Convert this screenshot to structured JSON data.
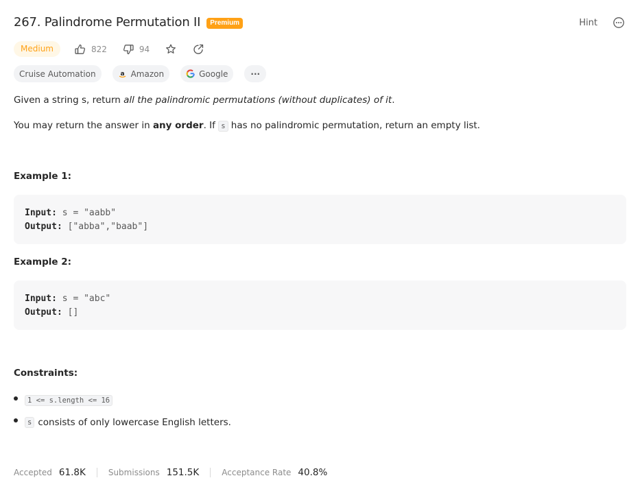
{
  "problem": {
    "title": "267. Palindrome Permutation II",
    "premium_badge": "Premium",
    "difficulty": "Medium",
    "likes": "822",
    "dislikes": "94"
  },
  "header_actions": {
    "hint": "Hint"
  },
  "tags": [
    {
      "label": "Cruise Automation"
    },
    {
      "label": "Amazon",
      "icon": "amazon-logo"
    },
    {
      "label": "Google",
      "icon": "google-logo"
    },
    {
      "label": "···"
    }
  ],
  "description": {
    "p1_prefix": "Given a string s, return ",
    "p1_em": "all the palindromic permutations (without duplicates) of it",
    "p1_suffix": ".",
    "p2_prefix": "You may return the answer in ",
    "p2_bold": "any order",
    "p2_mid": ". If ",
    "p2_code": "s",
    "p2_suffix": " has no palindromic permutation, return an empty list."
  },
  "examples": [
    {
      "title": "Example 1:",
      "input_label": "Input:",
      "input": " s = \"aabb\"",
      "output_label": "Output:",
      "output": " [\"abba\",\"baab\"]"
    },
    {
      "title": "Example 2:",
      "input_label": "Input:",
      "input": " s = \"abc\"",
      "output_label": "Output:",
      "output": " []"
    }
  ],
  "constraints": {
    "title": "Constraints:",
    "item1_code": "1 <= s.length <= 16",
    "item2_code": "s",
    "item2_text": "consists of only lowercase English letters."
  },
  "stats": {
    "accepted_label": "Accepted",
    "accepted_value": "61.8K",
    "submissions_label": "Submissions",
    "submissions_value": "151.5K",
    "rate_label": "Acceptance Rate",
    "rate_value": "40.8%"
  },
  "colors": {
    "accent": "#ffa116",
    "difficulty_bg": "#fff7e6",
    "tag_bg": "#f2f3f5",
    "code_bg": "#f7f7f8"
  }
}
